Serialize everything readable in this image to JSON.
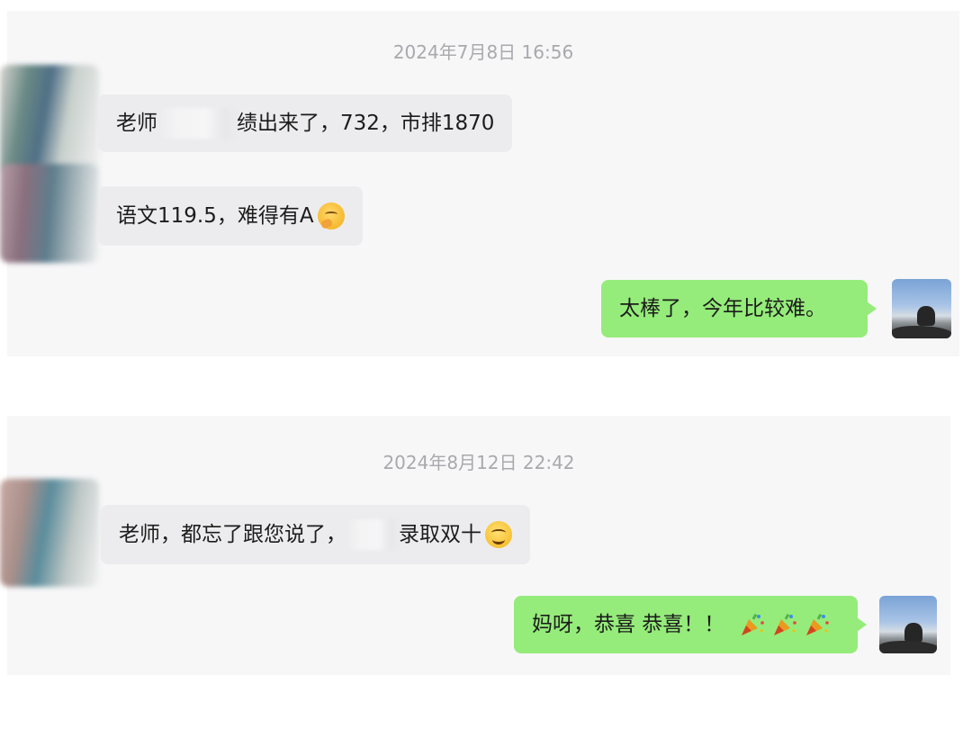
{
  "conversation": [
    {
      "timestamp": "2024年7月8日 16:56",
      "messages": [
        {
          "side": "left",
          "before_blur": "老师",
          "after_blur": "绩出来了，732，市排1870",
          "emoji": ""
        },
        {
          "side": "left",
          "before_blur": "语文119.5，难得有A",
          "after_blur": "",
          "emoji": "thinking-face-emoji"
        },
        {
          "side": "right",
          "text": "太棒了，今年比较难。"
        }
      ]
    },
    {
      "timestamp": "2024年8月12日 22:42",
      "messages": [
        {
          "side": "left",
          "before_blur": "老师，都忘了跟您说了，",
          "after_blur": "录取双十",
          "emoji": "smiling-face-emoji"
        },
        {
          "side": "right",
          "text": "妈呀，恭喜 恭喜！！",
          "emoji": "party-popper-emoji"
        }
      ]
    }
  ],
  "colors": {
    "panel_bg": "#f7f7f8",
    "incoming_bubble": "#ececee",
    "outgoing_bubble": "#95ec7a",
    "timestamp_text": "#a9a9ad"
  }
}
